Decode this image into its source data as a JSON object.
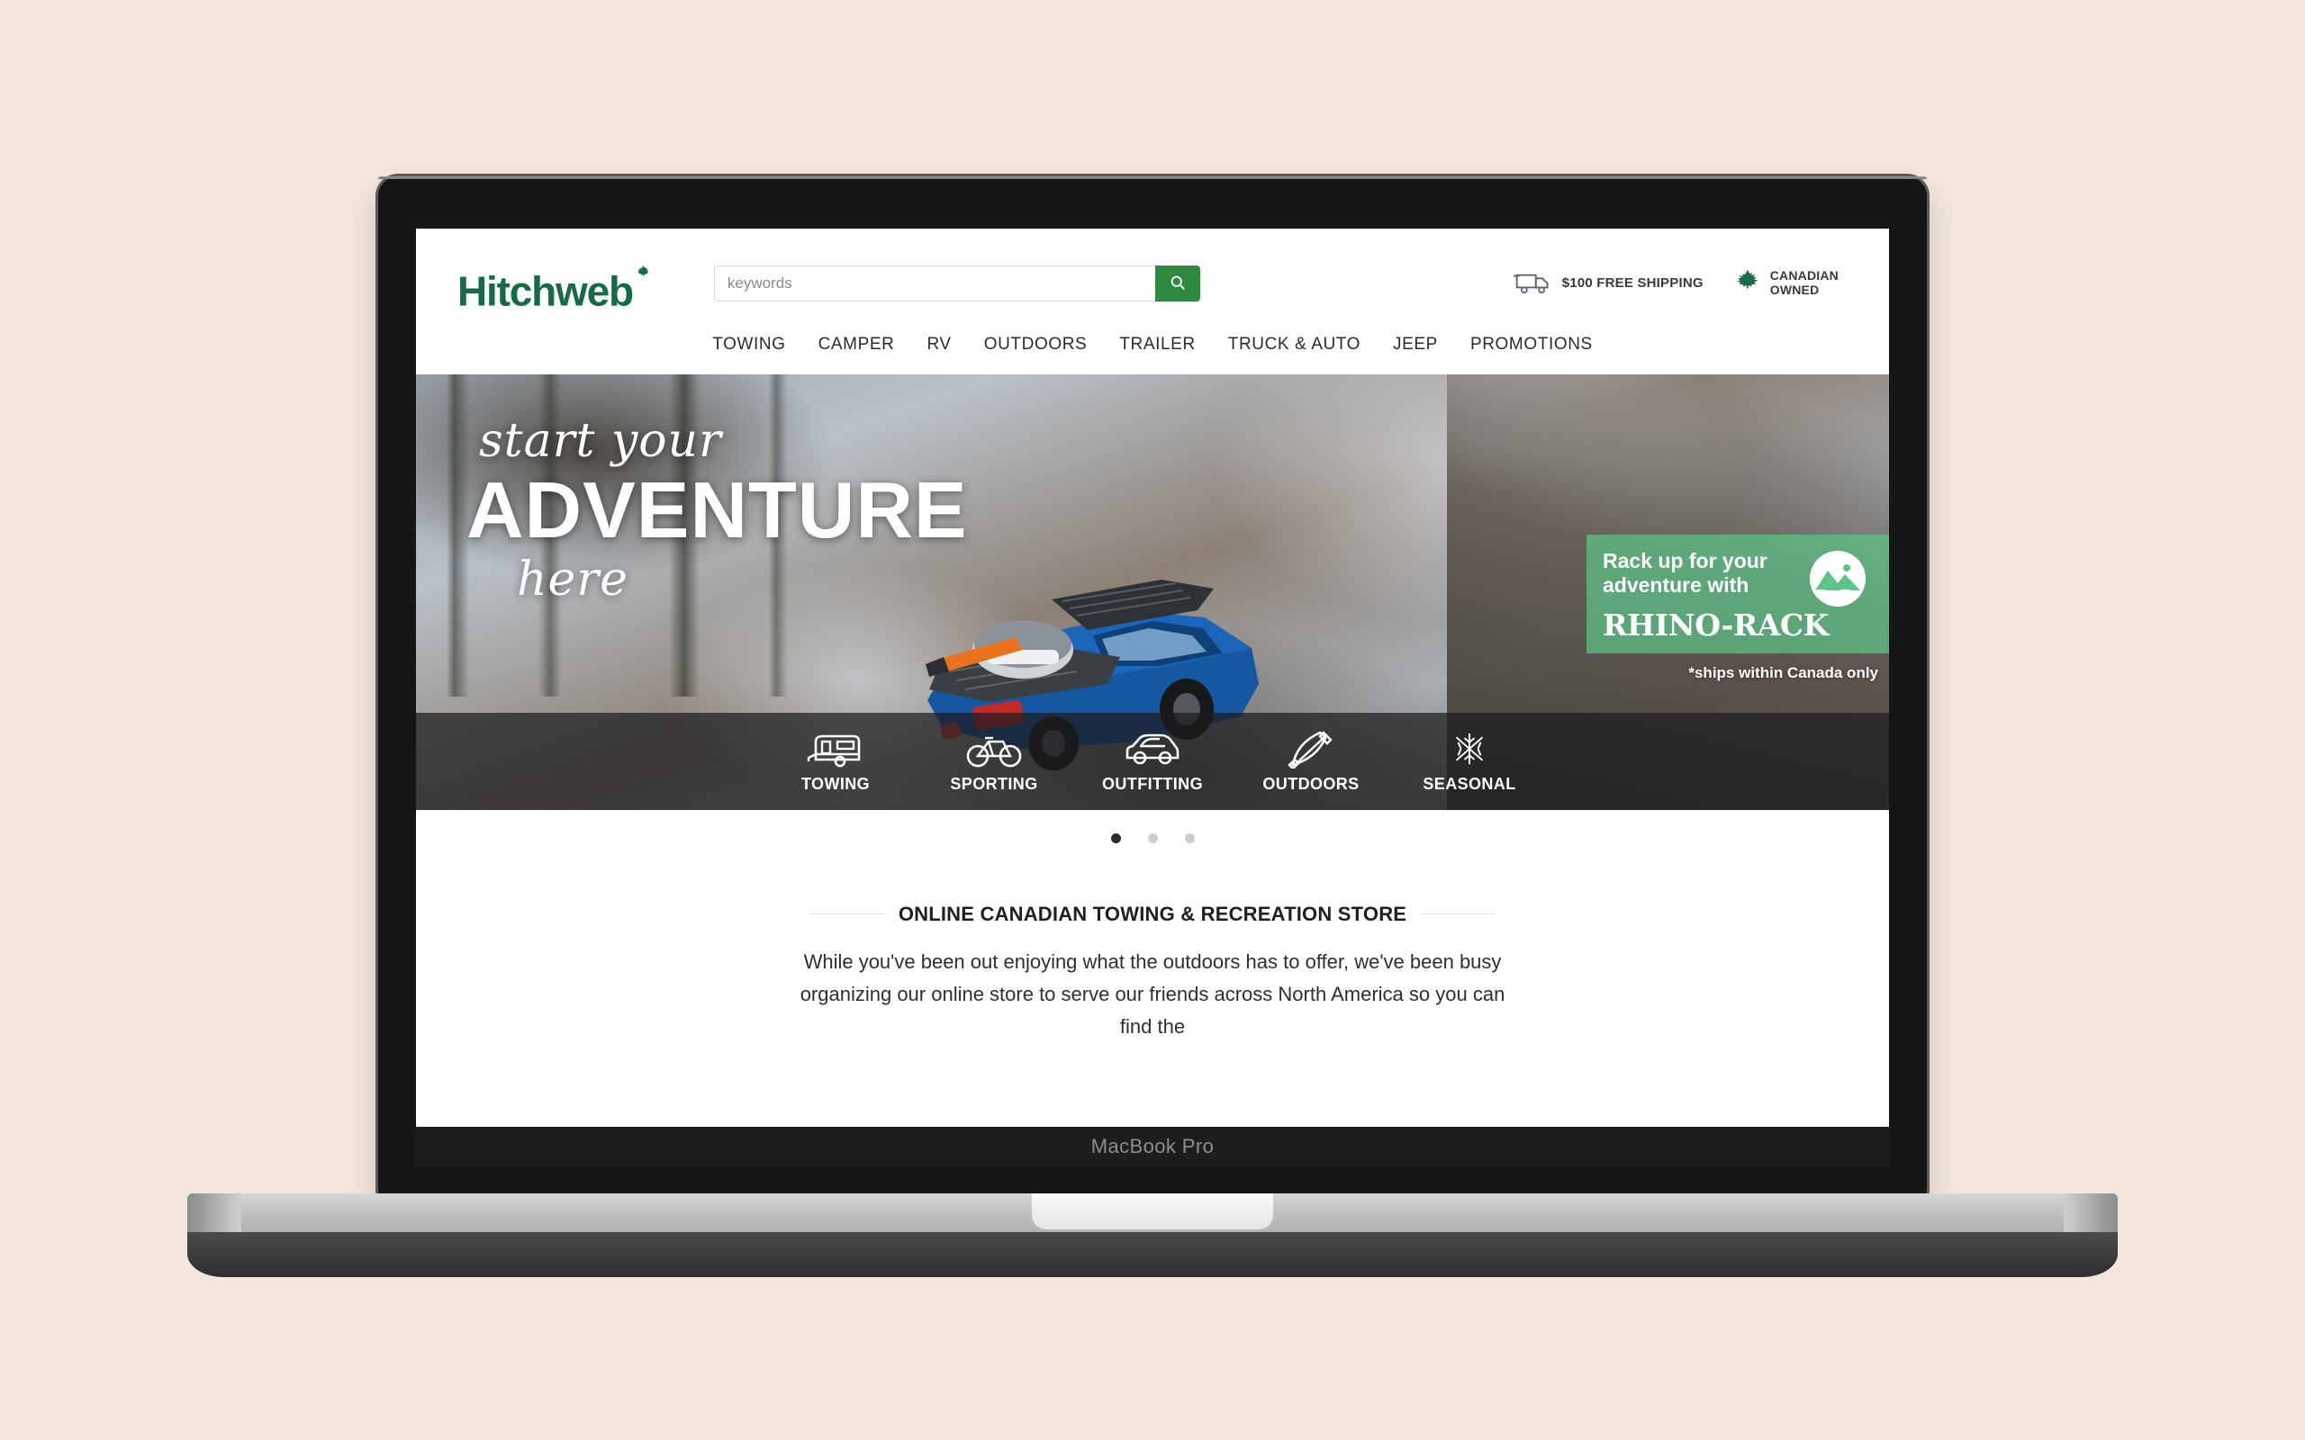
{
  "device": {
    "model_label": "MacBook Pro"
  },
  "header": {
    "logo_text": "Hitchweb",
    "logo_leaf_icon": "maple-leaf-icon",
    "search": {
      "placeholder": "keywords",
      "value": "",
      "button_icon": "search-icon"
    },
    "badges": [
      {
        "icon": "delivery-truck-icon",
        "text": "$100 FREE SHIPPING"
      },
      {
        "icon": "maple-leaf-icon",
        "line1": "CANADIAN",
        "line2": "OWNED"
      }
    ],
    "nav": [
      {
        "label": "TOWING"
      },
      {
        "label": "CAMPER"
      },
      {
        "label": "RV"
      },
      {
        "label": "OUTDOORS"
      },
      {
        "label": "TRAILER"
      },
      {
        "label": "TRUCK & AUTO"
      },
      {
        "label": "JEEP"
      },
      {
        "label": "PROMOTIONS"
      }
    ]
  },
  "hero": {
    "line1": "start your",
    "line2": "ADVENTURE",
    "line3": "here",
    "promo": {
      "headline": "Rack up for your adventure with",
      "brand": "RHINO-RACK",
      "logo_icon": "mountain-circle-icon",
      "note": "*ships within Canada only"
    },
    "categories": [
      {
        "label": "TOWING",
        "icon": "trailer-icon"
      },
      {
        "label": "SPORTING",
        "icon": "bicycle-icon"
      },
      {
        "label": "OUTFITTING",
        "icon": "car-icon"
      },
      {
        "label": "OUTDOORS",
        "icon": "kayak-paddle-icon"
      },
      {
        "label": "SEASONAL",
        "icon": "snowflake-icon"
      }
    ],
    "carousel": {
      "slide_count": 3,
      "active_index": 0
    }
  },
  "intro": {
    "heading": "ONLINE CANADIAN TOWING & RECREATION STORE",
    "body": "While you've been out enjoying what the outdoors has to offer, we've been busy organizing our online store to serve our friends across North America so you can find the"
  },
  "colors": {
    "page_background": "#f3e7dd",
    "brand_green": "#156c44",
    "search_button_green": "#2d8a3e",
    "promo_green": "#5cc486",
    "text_dark": "#2b2b2b"
  }
}
